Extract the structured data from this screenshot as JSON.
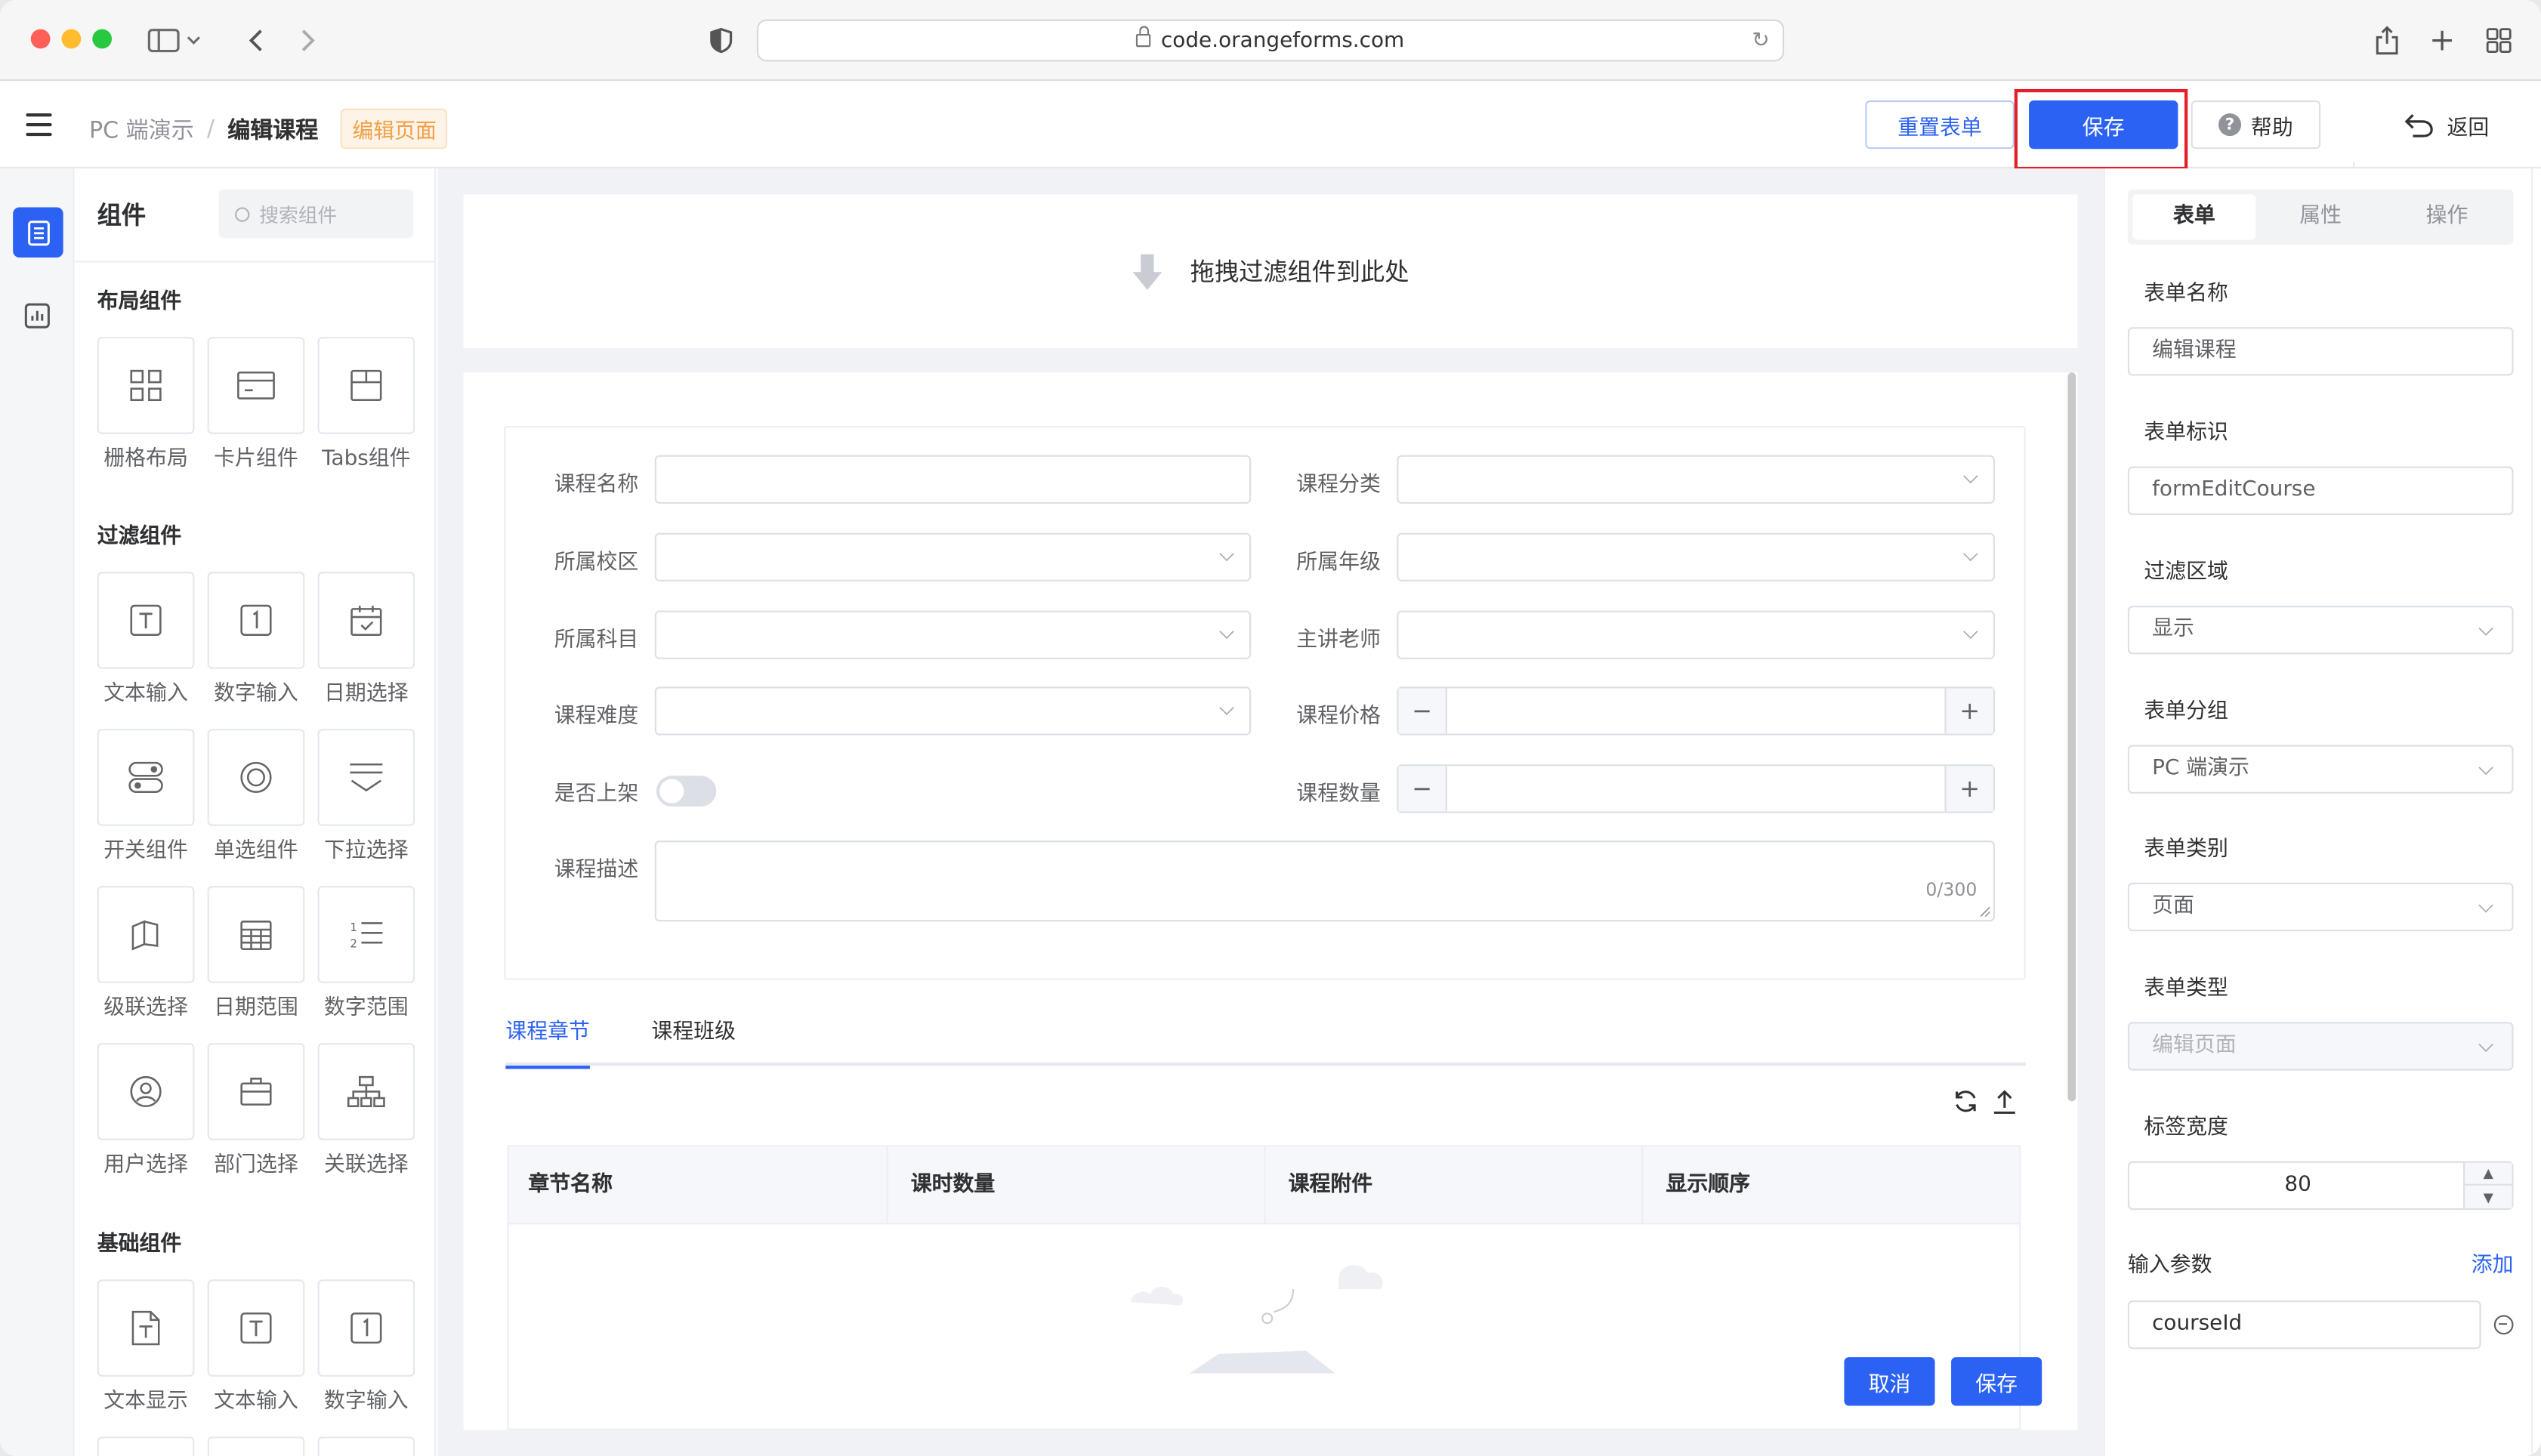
{
  "browser": {
    "url": "code.orangeforms.com"
  },
  "header": {
    "breadcrumb_root": "PC 端演示",
    "breadcrumb_sep": "/",
    "breadcrumb_current": "编辑课程",
    "page_tag": "编辑页面",
    "reset_label": "重置表单",
    "save_label": "保存",
    "help_label": "帮助",
    "back_label": "返回"
  },
  "components_panel": {
    "title": "组件",
    "search_placeholder": "搜索组件",
    "sections": [
      {
        "title": "布局组件",
        "items": [
          {
            "label": "栅格布局",
            "icon": "grid-icon"
          },
          {
            "label": "卡片组件",
            "icon": "card-icon"
          },
          {
            "label": "Tabs组件",
            "icon": "tabs-icon"
          }
        ]
      },
      {
        "title": "过滤组件",
        "items": [
          {
            "label": "文本输入",
            "icon": "text-input-icon"
          },
          {
            "label": "数字输入",
            "icon": "number-input-icon"
          },
          {
            "label": "日期选择",
            "icon": "calendar-icon"
          },
          {
            "label": "开关组件",
            "icon": "switch-icon"
          },
          {
            "label": "单选组件",
            "icon": "radio-icon"
          },
          {
            "label": "下拉选择",
            "icon": "dropdown-icon"
          },
          {
            "label": "级联选择",
            "icon": "cascader-icon"
          },
          {
            "label": "日期范围",
            "icon": "date-range-icon"
          },
          {
            "label": "数字范围",
            "icon": "number-range-icon"
          },
          {
            "label": "用户选择",
            "icon": "user-icon"
          },
          {
            "label": "部门选择",
            "icon": "department-icon"
          },
          {
            "label": "关联选择",
            "icon": "relation-icon"
          }
        ]
      },
      {
        "title": "基础组件",
        "items": [
          {
            "label": "文本显示",
            "icon": "text-display-icon"
          },
          {
            "label": "文本输入",
            "icon": "text-input-icon"
          },
          {
            "label": "数字输入",
            "icon": "number-input-icon"
          }
        ]
      }
    ]
  },
  "canvas": {
    "filter_drop_hint": "拖拽过滤组件到此处",
    "fields": {
      "course_name": "课程名称",
      "course_category": "课程分类",
      "campus": "所属校区",
      "grade": "所属年级",
      "subject": "所属科目",
      "teacher": "主讲老师",
      "difficulty": "课程难度",
      "price": "课程价格",
      "on_shelf": "是否上架",
      "quantity": "课程数量",
      "description": "课程描述",
      "description_counter": "0/300"
    },
    "tabs": [
      {
        "label": "课程章节",
        "active": true
      },
      {
        "label": "课程班级",
        "active": false
      }
    ],
    "table_headers": [
      "章节名称",
      "课时数量",
      "课程附件",
      "显示顺序"
    ],
    "cancel_label": "取消",
    "save_label": "保存"
  },
  "props_panel": {
    "tabs": [
      {
        "label": "表单",
        "active": true
      },
      {
        "label": "属性",
        "active": false
      },
      {
        "label": "操作",
        "active": false
      }
    ],
    "form_name_label": "表单名称",
    "form_name_value": "编辑课程",
    "form_id_label": "表单标识",
    "form_id_value": "formEditCourse",
    "filter_area_label": "过滤区域",
    "filter_area_value": "显示",
    "form_group_label": "表单分组",
    "form_group_value": "PC 端演示",
    "form_category_label": "表单类别",
    "form_category_value": "页面",
    "form_type_label": "表单类型",
    "form_type_value": "编辑页面",
    "label_width_label": "标签宽度",
    "label_width_value": "80",
    "input_params_label": "输入参数",
    "add_label": "添加",
    "param_value": "courseId"
  },
  "colors": {
    "primary": "#2b62f3",
    "highlight_box": "#e3202a",
    "tag_orange": "#f0a047"
  }
}
